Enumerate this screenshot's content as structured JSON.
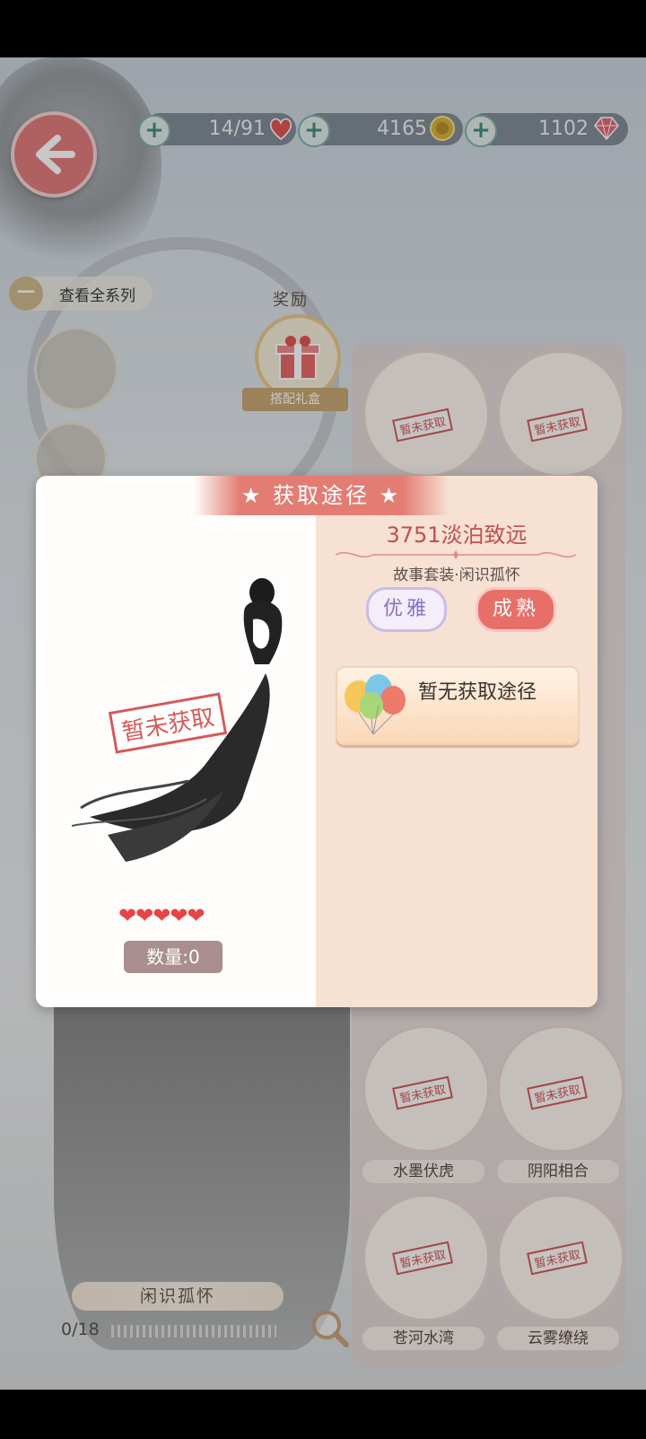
{
  "resources": [
    {
      "value": "14/91",
      "icon": "heart-icon",
      "color": "#e25555"
    },
    {
      "value": "4165",
      "icon": "gold-coin-icon",
      "color": "#d8b23c"
    },
    {
      "value": "1102",
      "icon": "diamond-icon",
      "color": "#e26a7a"
    }
  ],
  "series": {
    "label": "查看全系列"
  },
  "reward": {
    "title": "奖励",
    "label": "搭配礼盒"
  },
  "grid": {
    "not_obtained": "暂未获取",
    "items": [
      {
        "label": ""
      },
      {
        "label": ""
      },
      {
        "label": "水墨伏虎"
      },
      {
        "label": "阴阳相合"
      },
      {
        "label": "苍河水湾"
      },
      {
        "label": "云雾缭绕"
      }
    ]
  },
  "set": {
    "name": "闲识孤怀",
    "count": "0/18",
    "progress": 0.0
  },
  "dialog": {
    "title": "获取途径",
    "item_name": "3751淡泊致远",
    "subtitle": "故事套装·闲识孤怀",
    "tags": [
      "优雅",
      "成熟"
    ],
    "route_text": "暂无获取途径",
    "stamp": "暂未获取",
    "hearts": "❤❤❤❤❤",
    "stars": 5,
    "quantity": "数量:0"
  },
  "colors": {
    "accent": "#e37d74",
    "stamp": "#d45b5b"
  }
}
